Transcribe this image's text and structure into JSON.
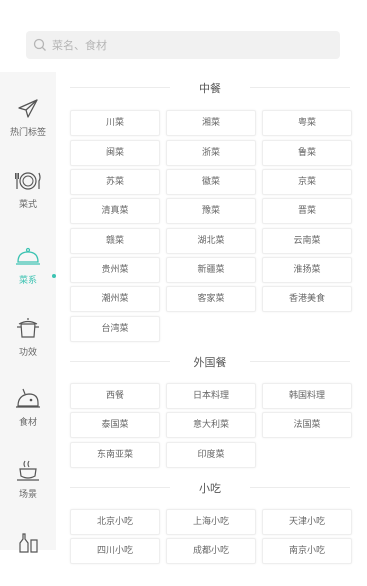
{
  "search": {
    "placeholder": "菜名、食材"
  },
  "sidebar": {
    "items": [
      {
        "label": "热门标签",
        "icon": "paper-plane-icon"
      },
      {
        "label": "菜式",
        "icon": "plate-cutlery-icon"
      },
      {
        "label": "菜系",
        "icon": "dish-cover-icon",
        "active": true
      },
      {
        "label": "功效",
        "icon": "pot-icon"
      },
      {
        "label": "食材",
        "icon": "ingredient-icon"
      },
      {
        "label": "场景",
        "icon": "cup-icon"
      }
    ]
  },
  "sections": [
    {
      "title": "中餐",
      "items": [
        "川菜",
        "湘菜",
        "粤菜",
        "闽菜",
        "浙菜",
        "鲁菜",
        "苏菜",
        "徽菜",
        "京菜",
        "清真菜",
        "豫菜",
        "晋菜",
        "赣菜",
        "湖北菜",
        "云南菜",
        "贵州菜",
        "新疆菜",
        "淮扬菜",
        "潮州菜",
        "客家菜",
        "香港美食",
        "台湾菜"
      ]
    },
    {
      "title": "外国餐",
      "items": [
        "西餐",
        "日本料理",
        "韩国料理",
        "泰国菜",
        "意大利菜",
        "法国菜",
        "东南亚菜",
        "印度菜"
      ]
    },
    {
      "title": "小吃",
      "items": [
        "北京小吃",
        "上海小吃",
        "天津小吃",
        "四川小吃",
        "成都小吃",
        "南京小吃"
      ]
    }
  ],
  "colors": {
    "accent": "#3cc3b2",
    "sidebar_bg": "#f6f6f6",
    "search_bg": "#f1f1f1"
  }
}
